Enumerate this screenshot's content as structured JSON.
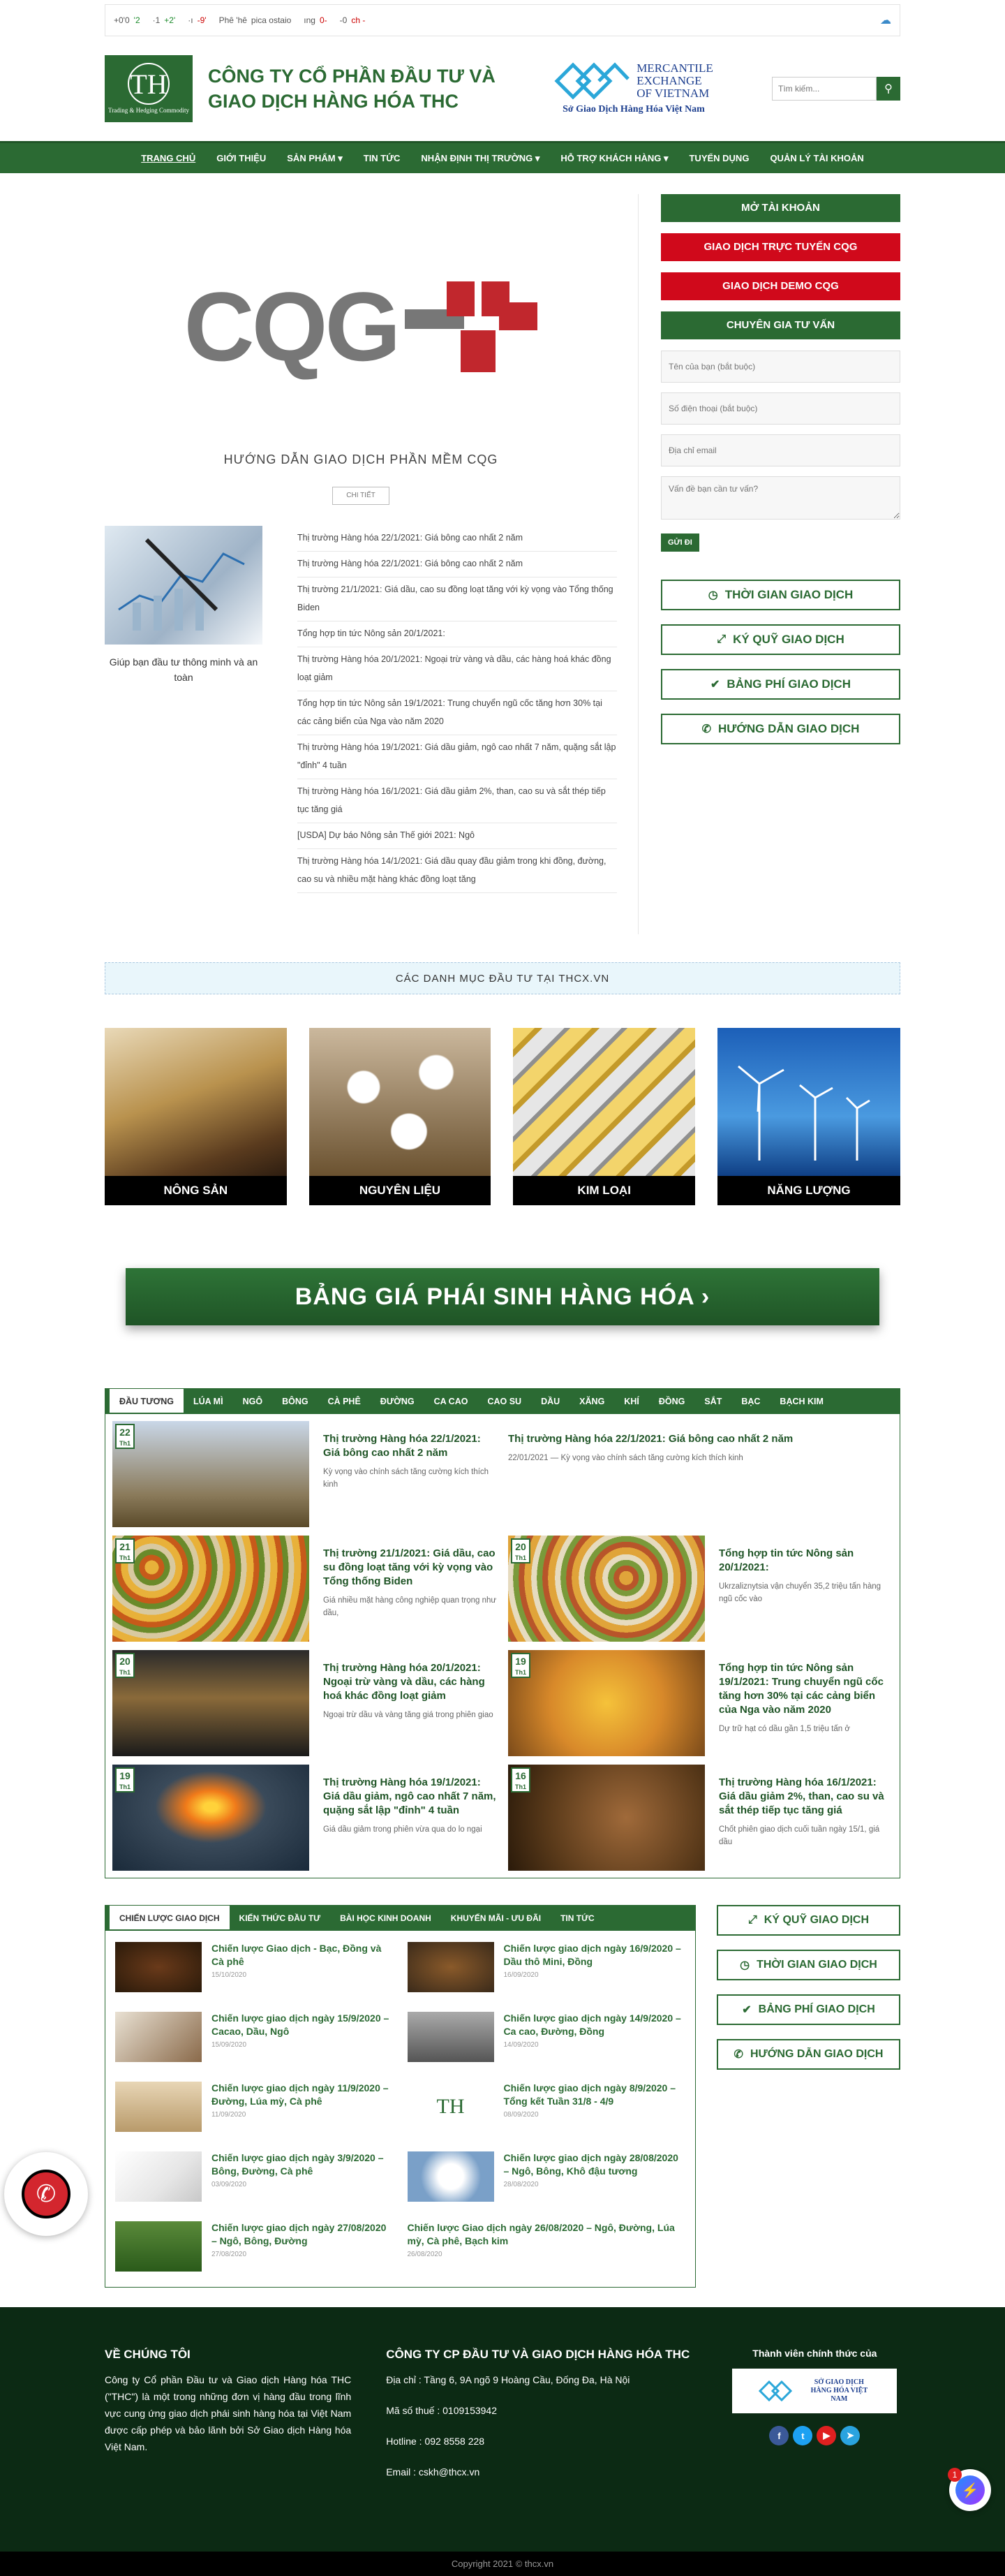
{
  "ticker": {
    "items": [
      {
        "label": "+0'0",
        "value": "'2",
        "dir": "up"
      },
      {
        "label": "·1",
        "value": "+2'",
        "dir": "up"
      },
      {
        "label": "·ı",
        "value": "-9'",
        "dir": "dn"
      },
      {
        "label": "Phê 'hê",
        "value": "pica ostaio",
        "dir": "up"
      },
      {
        "label": "ıng",
        "value": "0-",
        "dir": "dn"
      },
      {
        "label": "-0",
        "value": "ch -",
        "dir": "dn"
      }
    ]
  },
  "header": {
    "logo_mono": "TH",
    "logo_sub": "Trading & Hedging Commodity",
    "brand_line1": "CÔNG TY CỔ PHẦN ĐẦU TƯ VÀ",
    "brand_line2": "GIAO DỊCH HÀNG HÓA THC",
    "mxv_line1": "MERCANTILE",
    "mxv_line2": "EXCHANGE",
    "mxv_line3": "OF VIETNAM",
    "mxv_sub": "Sở Giao Dịch Hàng Hóa Việt Nam",
    "search_placeholder": "Tìm kiếm..."
  },
  "nav": {
    "items": [
      "TRANG CHỦ",
      "GIỚI THIỆU",
      "SẢN PHẨM ▾",
      "TIN TỨC",
      "NHẬN ĐỊNH THỊ TRƯỜNG ▾",
      "HỖ TRỢ KHÁCH HÀNG ▾",
      "TUYỂN DỤNG",
      "QUẢN LÝ TÀI KHOẢN"
    ]
  },
  "hero": {
    "logo_text": "CQG",
    "title": "HƯỚNG DẪN GIAO DỊCH PHẦN MỀM CQG",
    "detail_btn": "CHI TIẾT"
  },
  "featured": {
    "caption": "Giúp bạn đầu tư thông minh và an toàn"
  },
  "news_list": [
    "Thị trường Hàng hóa 22/1/2021: Giá bông cao nhất 2 năm",
    "Thị trường Hàng hóa 22/1/2021: Giá bông cao nhất 2 năm",
    "Thị trường 21/1/2021: Giá dầu, cao su đồng loạt tăng với kỳ vọng vào Tổng thống Biden",
    "Tổng hợp tin tức Nông sản 20/1/2021:",
    "Thị trường Hàng hóa 20/1/2021: Ngoại trừ vàng và dầu, các hàng hoá khác đồng loạt giảm",
    "Tổng hợp tin tức Nông sản 19/1/2021: Trung chuyển ngũ cốc tăng hơn 30% tại các cảng biển của Nga vào năm 2020",
    "Thị trường Hàng hóa 19/1/2021: Giá dầu giảm, ngô cao nhất 7 năm, quặng sắt lập \"đỉnh\" 4 tuần",
    "Thị trường Hàng hóa 16/1/2021: Giá dầu giảm 2%, than, cao su và sắt thép tiếp tục tăng giá",
    "[USDA] Dự báo Nông sản Thế giới 2021: Ngô",
    "Thị trường Hàng hóa 14/1/2021: Giá dầu quay đầu giảm trong khi đồng, đường, cao su và nhiều mặt hàng khác đồng loạt tăng"
  ],
  "sidebar": {
    "open_account": "MỞ TÀI KHOẢN",
    "trade_online": "GIAO DỊCH TRỰC TUYẾN CQG",
    "trade_demo": "GIAO DỊCH DEMO CQG",
    "consultant": "CHUYÊN GIA TƯ VẤN",
    "name_ph": "Tên của bạn (bắt buộc)",
    "phone_ph": "Số điện thoại (bắt buộc)",
    "email_ph": "Địa chỉ email",
    "question_ph": "Vấn đề bạn cần tư vấn?",
    "send": "GỬI ĐI",
    "btn_time": "THỜI GIAN GIAO DỊCH",
    "btn_fund": "KÝ QUỸ GIAO DỊCH",
    "btn_fee": "BẢNG PHÍ GIAO DỊCH",
    "btn_guide": "HƯỚNG DẪN GIAO DỊCH"
  },
  "categories": {
    "title": "CÁC DANH MỤC ĐẦU TƯ TẠI THCX.VN",
    "items": [
      "NÔNG SẢN",
      "NGUYÊN LIỆU",
      "KIM LOẠI",
      "NĂNG LƯỢNG"
    ]
  },
  "price_board": "BẢNG GIÁ PHÁI SINH HÀNG HÓA ›",
  "market_tabs": [
    "ĐẦU TƯƠNG",
    "LÚA MÌ",
    "NGÔ",
    "BÔNG",
    "CÀ PHÊ",
    "ĐƯỜNG",
    "CA CAO",
    "CAO SU",
    "DẦU",
    "XĂNG",
    "KHÍ",
    "ĐỒNG",
    "SẮT",
    "BẠC",
    "BẠCH KIM"
  ],
  "market_posts": [
    {
      "day": "22",
      "mon": "Th1",
      "title": "Thị trường Hàng hóa 22/1/2021: Giá bông cao nhất 2 năm",
      "desc": "Kỳ vọng vào chính sách tăng cường kích thích kinh"
    },
    {
      "day": "",
      "mon": "",
      "title": "Thị trường Hàng hóa 22/1/2021: Giá bông cao nhất 2 năm",
      "desc": "22/01/2021 — Kỳ vọng vào chính sách tăng cường kích thích kinh"
    },
    {
      "day": "21",
      "mon": "Th1",
      "title": "Thị trường 21/1/2021: Giá dầu, cao su đồng loạt tăng với kỳ vọng vào Tổng thống Biden",
      "desc": "Giá nhiều mặt hàng công nghiệp quan trọng như dầu,"
    },
    {
      "day": "20",
      "mon": "Th1",
      "title": "Tổng hợp tin tức Nông sản 20/1/2021:",
      "desc": "Ukrzaliznytsia vận chuyển 35,2 triệu tấn hàng ngũ cốc vào"
    },
    {
      "day": "20",
      "mon": "Th1",
      "title": "Thị trường Hàng hóa 20/1/2021: Ngoại trừ vàng và dầu, các hàng hoá khác đồng loạt giảm",
      "desc": "Ngoại trừ dầu và vàng tăng giá trong phiên giao"
    },
    {
      "day": "19",
      "mon": "Th1",
      "title": "Tổng hợp tin tức Nông sản 19/1/2021: Trung chuyển ngũ cốc tăng hơn 30% tại các cảng biển của Nga vào năm 2020",
      "desc": "Dự trữ hạt có dầu gần 1,5 triệu tấn ở"
    },
    {
      "day": "19",
      "mon": "Th1",
      "title": "Thị trường Hàng hóa 19/1/2021: Giá dầu giảm, ngô cao nhất 7 năm, quặng sắt lập \"đỉnh\" 4 tuần",
      "desc": "Giá dầu giảm trong phiên vừa qua do lo ngại"
    },
    {
      "day": "16",
      "mon": "Th1",
      "title": "Thị trường Hàng hóa 16/1/2021: Giá dầu giảm 2%, than, cao su và sắt thép tiếp tục tăng giá",
      "desc": "Chốt phiên giao dịch cuối tuần ngày 15/1, giá dầu"
    }
  ],
  "strategy_tabs": [
    "CHIẾN LƯỢC GIAO DỊCH",
    "KIẾN THỨC ĐẦU TƯ",
    "BÀI HỌC KINH DOANH",
    "KHUYẾN MÃI - ƯU ĐÃI",
    "TIN TỨC"
  ],
  "strategy_posts": [
    {
      "title": "Chiến lược Giao dịch - Bạc, Đồng và Cà phê",
      "date": "15/10/2020"
    },
    {
      "title": "Chiến lược giao dịch ngày 16/9/2020 – Dầu thô Mini, Đồng",
      "date": "16/09/2020"
    },
    {
      "title": "Chiến lược giao dịch ngày 15/9/2020 – Cacao, Dầu, Ngô",
      "date": "15/09/2020"
    },
    {
      "title": "Chiến lược giao dịch ngày 14/9/2020 – Ca cao, Đường, Đồng",
      "date": "14/09/2020"
    },
    {
      "title": "Chiến lược giao dịch ngày 11/9/2020 – Đường, Lúa mỳ, Cà phê",
      "date": "11/09/2020"
    },
    {
      "title": "Chiến lược giao dịch ngày 8/9/2020 – Tổng kết Tuần 31/8 - 4/9",
      "date": "08/09/2020"
    },
    {
      "title": "Chiến lược giao dịch ngày 3/9/2020 – Bông, Đường, Cà phê",
      "date": "03/09/2020"
    },
    {
      "title": "Chiến lược giao dịch ngày 28/08/2020 – Ngô, Bông, Khô đậu tương",
      "date": "28/08/2020"
    },
    {
      "title": "Chiến lược giao dịch ngày 27/08/2020 – Ngô, Bông, Đường",
      "date": "27/08/2020"
    },
    {
      "title": "Chiến lược Giao dịch ngày 26/08/2020 – Ngô, Đường, Lúa mỳ, Cà phê, Bạch kim",
      "date": "26/08/2020"
    }
  ],
  "footer": {
    "about_title": "VỀ CHÚNG TÔI",
    "about_text": "Công ty Cổ phần Đầu tư và Giao dịch Hàng hóa THC (\"THC\") là một trong những đơn vị hàng đầu trong lĩnh vực cung ứng giao dịch phái sinh hàng hóa tại Việt Nam được cấp phép và bảo lãnh bởi Sở Giao dịch Hàng hóa Việt Nam.",
    "company_title": "CÔNG TY CP ĐẦU TƯ VÀ GIAO DỊCH HÀNG HÓA THC",
    "address": "Địa chỉ : Tầng 6, 9A ngõ 9 Hoàng Cầu, Đống Đa, Hà Nội",
    "tax": "Mã số thuế : 0109153942",
    "hotline": "Hotline : 092 8558 228",
    "email": "Email : cskh@thcx.vn",
    "member_title": "Thành viên chính thức của",
    "partner_text": "SỞ GIAO DỊCH HÀNG HÓA VIỆT NAM",
    "copyright": "Copyright 2021 © thcx.vn"
  },
  "messenger_badge": "1"
}
